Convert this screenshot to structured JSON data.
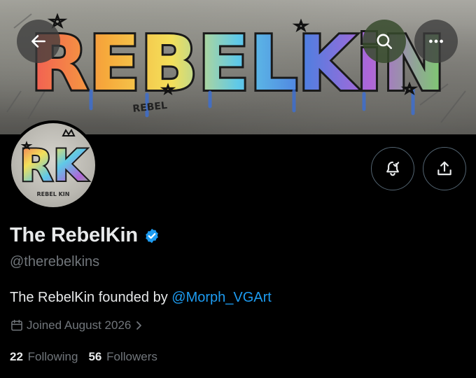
{
  "banner": {
    "art_text": "REBELKiN",
    "tag_text": "REBEL"
  },
  "avatar": {
    "monogram": "RK",
    "caption": "REBEL KIN"
  },
  "nav": {
    "back_icon": "arrow-left-icon",
    "search_icon": "search-icon",
    "more_icon": "more-horizontal-icon"
  },
  "actions": {
    "notify_icon": "bell-check-icon",
    "share_icon": "share-icon"
  },
  "profile": {
    "display_name": "The RebelKin",
    "verified_color": "#1d9bf0",
    "handle": "@therebelkins",
    "bio_text": "The RebelKin founded by ",
    "bio_mention": "@Morph_VGArt",
    "joined": "Joined August 2026",
    "following_count": "22",
    "following_label": "Following",
    "followers_count": "56",
    "followers_label": "Followers"
  },
  "colors": {
    "background": "#000000",
    "text_primary": "#e7e9ea",
    "text_secondary": "#71767b",
    "link": "#1d9bf0",
    "button_border": "#536471"
  }
}
